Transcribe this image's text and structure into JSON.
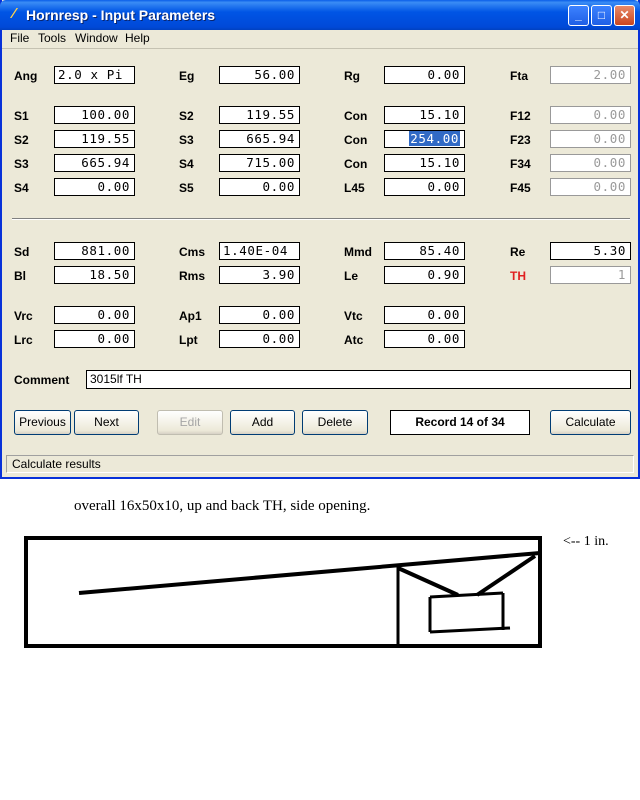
{
  "window": {
    "title": "Hornresp - Input Parameters"
  },
  "menu": {
    "file": "File",
    "tools": "Tools",
    "window": "Window",
    "help": "Help"
  },
  "params": {
    "ang": {
      "label": "Ang",
      "value": "2.0 x Pi"
    },
    "eg": {
      "label": "Eg",
      "value": "56.00"
    },
    "rg": {
      "label": "Rg",
      "value": "0.00"
    },
    "fta": {
      "label": "Fta",
      "value": "2.00"
    },
    "s1_a": {
      "label": "S1",
      "value": "100.00"
    },
    "s2_b": {
      "label": "S2",
      "value": "119.55"
    },
    "con_c1": {
      "label": "Con",
      "value": "15.10"
    },
    "f12": {
      "label": "F12",
      "value": "0.00"
    },
    "s2_a": {
      "label": "S2",
      "value": "119.55"
    },
    "s3_b": {
      "label": "S3",
      "value": "665.94"
    },
    "con_c2": {
      "label": "Con",
      "value": "254.00"
    },
    "f23": {
      "label": "F23",
      "value": "0.00"
    },
    "s3_a": {
      "label": "S3",
      "value": "665.94"
    },
    "s4_b": {
      "label": "S4",
      "value": "715.00"
    },
    "con_c3": {
      "label": "Con",
      "value": "15.10"
    },
    "f34": {
      "label": "F34",
      "value": "0.00"
    },
    "s4_a": {
      "label": "S4",
      "value": "0.00"
    },
    "s5_b": {
      "label": "S5",
      "value": "0.00"
    },
    "l45": {
      "label": "L45",
      "value": "0.00"
    },
    "f45": {
      "label": "F45",
      "value": "0.00"
    },
    "sd": {
      "label": "Sd",
      "value": "881.00"
    },
    "cms": {
      "label": "Cms",
      "value": "1.40E-04"
    },
    "mmd": {
      "label": "Mmd",
      "value": "85.40"
    },
    "re": {
      "label": "Re",
      "value": "5.30"
    },
    "bl": {
      "label": "Bl",
      "value": "18.50"
    },
    "rms": {
      "label": "Rms",
      "value": "3.90"
    },
    "le": {
      "label": "Le",
      "value": "0.90"
    },
    "th": {
      "label": "TH",
      "value": "1"
    },
    "vrc": {
      "label": "Vrc",
      "value": "0.00"
    },
    "ap1": {
      "label": "Ap1",
      "value": "0.00"
    },
    "vtc": {
      "label": "Vtc",
      "value": "0.00"
    },
    "lrc": {
      "label": "Lrc",
      "value": "0.00"
    },
    "lpt": {
      "label": "Lpt",
      "value": "0.00"
    },
    "atc": {
      "label": "Atc",
      "value": "0.00"
    }
  },
  "comment": {
    "label": "Comment",
    "value": "3015lf TH"
  },
  "buttons": {
    "previous": "Previous",
    "next": "Next",
    "edit": "Edit",
    "add": "Add",
    "delete": "Delete",
    "calculate": "Calculate"
  },
  "record": "Record 14 of 34",
  "status": "Calculate results",
  "caption": "overall 16x50x10, up and back TH, side opening.",
  "sketch_note": "<-- 1 in.",
  "colors": {
    "th_label": "#e02020",
    "selection": "#316ac5",
    "titlebar": "#0055e5"
  }
}
